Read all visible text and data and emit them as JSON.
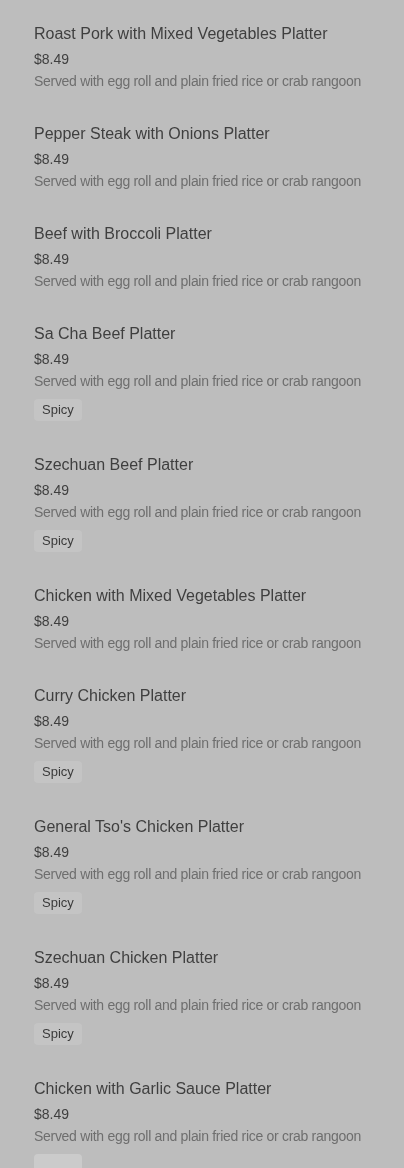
{
  "items": [
    {
      "name": "Roast Pork with Mixed Vegetables Platter",
      "price": "$8.49",
      "description": "Served with egg roll and plain fried rice or crab rangoon"
    },
    {
      "name": "Pepper Steak with Onions Platter",
      "price": "$8.49",
      "description": "Served with egg roll and plain fried rice or crab rangoon"
    },
    {
      "name": "Beef with Broccoli Platter",
      "price": "$8.49",
      "description": "Served with egg roll and plain fried rice or crab rangoon"
    },
    {
      "name": "Sa Cha Beef Platter",
      "price": "$8.49",
      "description": "Served with egg roll and plain fried rice or crab rangoon",
      "tags": [
        "Spicy"
      ]
    },
    {
      "name": "Szechuan Beef Platter",
      "price": "$8.49",
      "description": "Served with egg roll and plain fried rice or crab rangoon",
      "tags": [
        "Spicy"
      ]
    },
    {
      "name": "Chicken with Mixed Vegetables Platter",
      "price": "$8.49",
      "description": "Served with egg roll and plain fried rice or crab rangoon"
    },
    {
      "name": "Curry Chicken Platter",
      "price": "$8.49",
      "description": "Served with egg roll and plain fried rice or crab rangoon",
      "tags": [
        "Spicy"
      ]
    },
    {
      "name": "General Tso's Chicken Platter",
      "price": "$8.49",
      "description": "Served with egg roll and plain fried rice or crab rangoon",
      "tags": [
        "Spicy"
      ]
    },
    {
      "name": "Szechuan Chicken Platter",
      "price": "$8.49",
      "description": "Served with egg roll and plain fried rice or crab rangoon",
      "tags": [
        "Spicy"
      ]
    },
    {
      "name": "Chicken with Garlic Sauce Platter",
      "price": "$8.49",
      "description": "Served with egg roll and plain fried rice or crab rangoon",
      "cut_off_tag": true
    }
  ]
}
